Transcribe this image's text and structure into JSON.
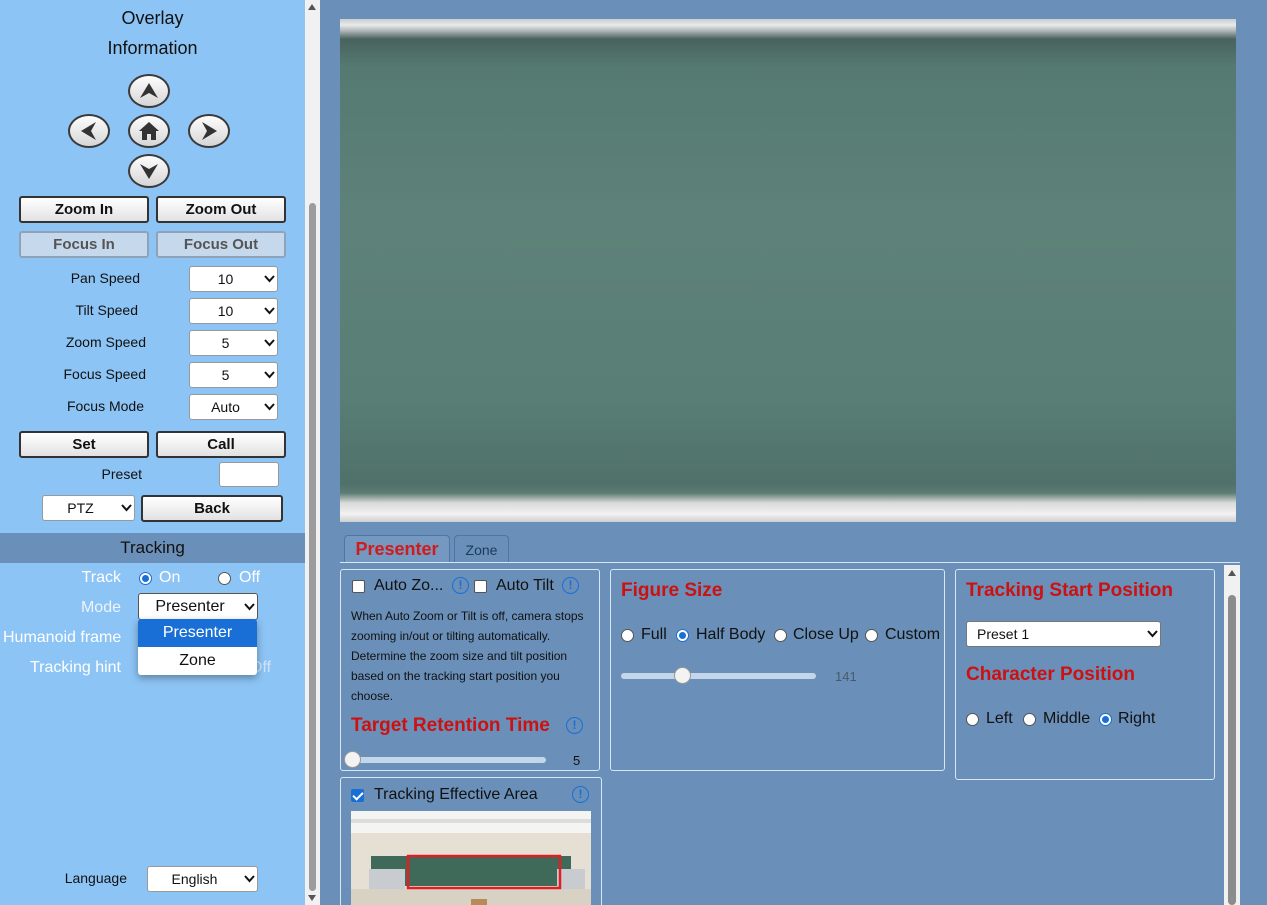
{
  "left": {
    "overlay_line1": "Overlay",
    "overlay_line2": "Information",
    "zoom_in": "Zoom In",
    "zoom_out": "Zoom Out",
    "focus_in": "Focus In",
    "focus_out": "Focus Out",
    "speeds": [
      {
        "label": "Pan Speed",
        "value": "10"
      },
      {
        "label": "Tilt Speed",
        "value": "10"
      },
      {
        "label": "Zoom Speed",
        "value": "5"
      },
      {
        "label": "Focus Speed",
        "value": "5"
      },
      {
        "label": "Focus Mode",
        "value": "Auto"
      }
    ],
    "set": "Set",
    "call": "Call",
    "preset_label": "Preset",
    "preset_value": "",
    "ptz_value": "PTZ",
    "back": "Back",
    "tracking_header": "Tracking",
    "track_label": "Track",
    "track_on": "On",
    "track_off": "Off",
    "mode_label": "Mode",
    "mode_value": "Presenter",
    "mode_options": [
      "Presenter",
      "Zone"
    ],
    "humanoid_label": "Humanoid frame",
    "hint_label": "Tracking hint",
    "language_label": "Language",
    "language_value": "English"
  },
  "tabs": {
    "presenter": "Presenter",
    "zone": "Zone"
  },
  "presenter": {
    "auto_zoom": "Auto Zo...",
    "auto_tilt": "Auto Tilt",
    "description_lines": [
      "When Auto Zoom or Tilt is off, camera stops",
      "zooming in/out or tilting automatically.",
      "Determine the zoom size and tilt position",
      "based on the tracking start position you",
      "choose."
    ],
    "retention_title": "Target Retention Time",
    "retention_value": "5",
    "retention_fraction": 0.0,
    "effective_area": "Tracking Effective Area",
    "effective_area_checked": true,
    "figure_title": "Figure Size",
    "figure_options": [
      "Full",
      "Half Body",
      "Close Up",
      "Custom"
    ],
    "figure_selected": "Half Body",
    "figure_value": "141",
    "figure_fraction": 0.3,
    "start_title": "Tracking Start Position",
    "start_value": "Preset 1",
    "char_title": "Character Position",
    "char_options": [
      "Left",
      "Middle",
      "Right"
    ],
    "char_selected": "Right",
    "info_glyph": "!"
  },
  "colors": {
    "panel_bg": "#8cc4f5",
    "main_bg": "#6a8fb8",
    "accent": "#1a6fd6",
    "heading_red": "#cc1111"
  }
}
